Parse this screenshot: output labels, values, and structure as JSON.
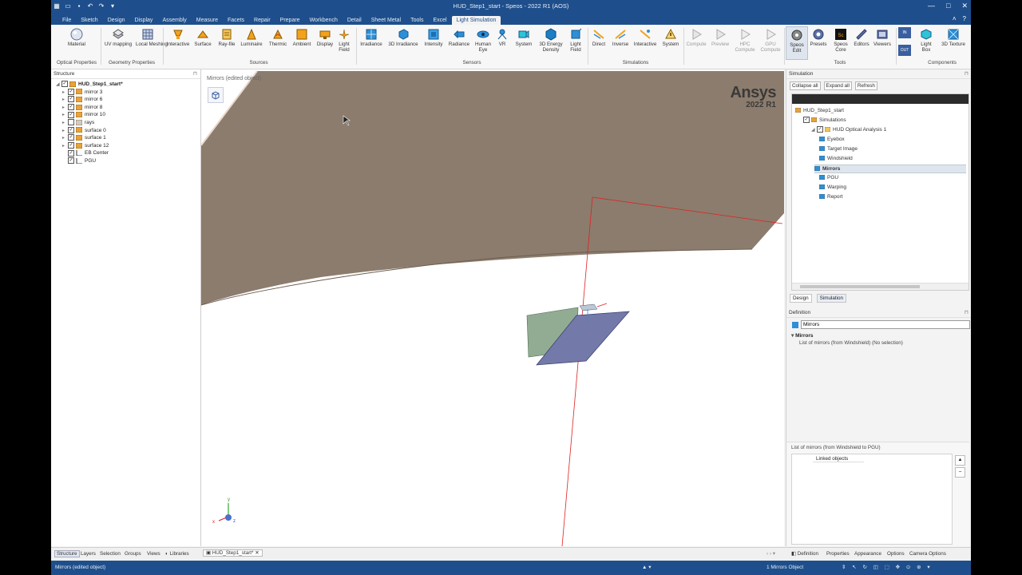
{
  "window": {
    "title": "HUD_Step1_start - Speos - 2022 R1 (AOS)",
    "min_glyph": "—",
    "max_glyph": "□",
    "close_glyph": "✕",
    "help_glyph": "?",
    "ribbon_min_glyph": "˄"
  },
  "menu_tabs": [
    "File",
    "Sketch",
    "Design",
    "Display",
    "Assembly",
    "Measure",
    "Facets",
    "Repair",
    "Prepare",
    "Workbench",
    "Detail",
    "Sheet Metal",
    "Tools",
    "Excel",
    "Light Simulation"
  ],
  "active_tab": "Light Simulation",
  "ribbon": {
    "optical_properties": {
      "label": "Optical Properties",
      "items": [
        "Material"
      ]
    },
    "geometry_properties": {
      "label": "Geometry Properties",
      "items": [
        "UV mapping",
        "Local Meshing"
      ]
    },
    "sources": {
      "label": "Sources",
      "items": [
        "Interactive",
        "Surface",
        "Ray-file",
        "Luminaire",
        "Thermic",
        "Ambient",
        "Display",
        "Light Field"
      ]
    },
    "sensors": {
      "label": "Sensors",
      "items": [
        "Irradiance",
        "3D Irradiance",
        "Intensity",
        "Radiance",
        "Human Eye",
        "VR",
        "System",
        "3D Energy Density",
        "Light Field"
      ]
    },
    "simulations": {
      "label": "Simulations",
      "items": [
        "Direct",
        "Inverse",
        "Interactive",
        "System"
      ]
    },
    "compute": {
      "items": [
        "Compute",
        "Preview",
        "HPC Compute",
        "GPU Compute"
      ]
    },
    "tools": {
      "label": "Tools",
      "items": [
        "Speos Edit",
        "Presets",
        "Speos Core",
        "Editors",
        "Viewers"
      ]
    },
    "components": {
      "label": "Components",
      "items": [
        "Light Box",
        "3D Texture"
      ]
    },
    "io": {
      "in": "IN",
      "out": "OUT"
    }
  },
  "structure_panel": {
    "title": "Structure",
    "pin": "⊓",
    "root": "HUD_Step1_start*",
    "items": [
      {
        "label": "mirror 3",
        "checked": true
      },
      {
        "label": "mirror 6",
        "checked": true
      },
      {
        "label": "mirror 8",
        "checked": true
      },
      {
        "label": "mirror 10",
        "checked": true
      },
      {
        "label": "rays",
        "checked": false
      },
      {
        "label": "surface 0",
        "checked": true
      },
      {
        "label": "surface 1",
        "checked": true
      },
      {
        "label": "surface 12",
        "checked": true
      },
      {
        "label": "EB Center",
        "checked": true
      },
      {
        "label": "PGU",
        "checked": true
      }
    ]
  },
  "viewport": {
    "label": "Mirrors (edited object)",
    "brand": "Ansys",
    "version": "2022 R1",
    "axis_x": "x",
    "axis_y": "y",
    "axis_z": "z"
  },
  "simulation_panel": {
    "title": "Simulation",
    "buttons": [
      "Collapse all",
      "Expand all",
      "Refresh"
    ],
    "tree": [
      {
        "label": "HUD_Step1_start",
        "level": 0
      },
      {
        "label": "Simulations",
        "level": 1
      },
      {
        "label": "HUD Optical Analysis 1",
        "level": 2
      },
      {
        "label": "Eyebox",
        "level": 3
      },
      {
        "label": "Target Image",
        "level": 3
      },
      {
        "label": "Windshield",
        "level": 3
      },
      {
        "label": "Mirrors",
        "level": 3,
        "selected": true
      },
      {
        "label": "PGU",
        "level": 3
      },
      {
        "label": "Warping",
        "level": 3
      },
      {
        "label": "Report",
        "level": 3
      }
    ],
    "tabs": [
      "Design",
      "Simulation"
    ]
  },
  "definition_panel": {
    "title": "Definition",
    "name_value": "Mirrors",
    "section": "Mirrors",
    "list_text": "List of mirrors (from Windshield) (No selection)",
    "list_header": "List of mirrors (from Windshield to PGU)",
    "column": "Linked objects",
    "up_glyph": "▲",
    "minus_glyph": "−"
  },
  "bottom_tabs_left": [
    "Structure",
    "Layers",
    "Selection",
    "Groups",
    "Views",
    "Libraries"
  ],
  "doc_tab": "HUD_Step1_start*",
  "bottom_tabs_right": [
    "Definition",
    "Properties",
    "Appearance",
    "Options",
    "Camera Options"
  ],
  "status": {
    "left": "Mirrors (edited object)",
    "count": "1 Mirrors Object"
  },
  "colors": {
    "titlebar": "#1e4f8c",
    "surface_brown": "#8c7c6d",
    "accent_orange": "#f3a21b",
    "sensor_blue": "#2e8fd6",
    "axis_red": "#e02020"
  }
}
